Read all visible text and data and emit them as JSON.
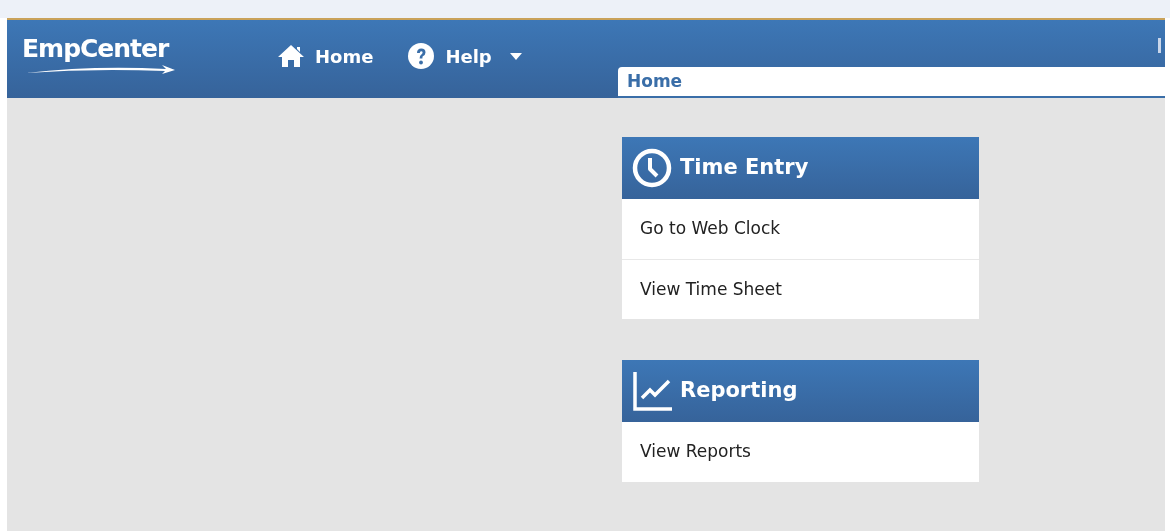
{
  "header": {
    "logo": "EmpCenter",
    "nav": [
      {
        "kind": "home",
        "label": "Home",
        "dropdown": false
      },
      {
        "kind": "help",
        "label": "Help",
        "dropdown": true
      }
    ]
  },
  "tabs": [
    {
      "label": "Home",
      "selected": true
    }
  ],
  "panels": [
    {
      "kind": "clock",
      "title": "Time Entry",
      "items": [
        "Go to Web Clock",
        "View Time Sheet"
      ]
    },
    {
      "kind": "chart",
      "title": "Reporting",
      "items": [
        "View Reports"
      ]
    }
  ]
}
